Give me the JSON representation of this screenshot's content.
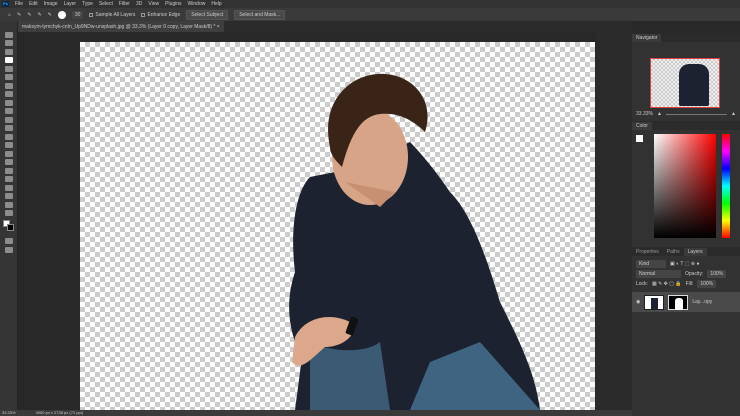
{
  "menu": [
    "File",
    "Edit",
    "Image",
    "Layer",
    "Type",
    "Select",
    "Filter",
    "3D",
    "View",
    "Plugins",
    "Window",
    "Help"
  ],
  "options": {
    "size": "30",
    "sample_all": "Sample All Layers",
    "enhance": "Enhance Edge",
    "select_subject": "Select Subject",
    "select_mask": "Select and Mask..."
  },
  "document_tab": "maksym-tymchyk-cnIn_Up9NDw-unsplash.jpg @ 33.3% (Layer 0 copy, Layer Mask/8) *",
  "status": {
    "zoom": "33.33%",
    "doc": "4000 px x 2738 px (72 ppi)"
  },
  "navigator": {
    "title": "Navigator",
    "zoom": "33.33%"
  },
  "color": {
    "title": "Color"
  },
  "layers": {
    "tabs": [
      "Properties",
      "Paths",
      "Layers"
    ],
    "kind": "Kind",
    "blend": "Normal",
    "opacity_label": "Opacity:",
    "opacity": "100%",
    "lock_label": "Lock:",
    "fill_label": "Fill:",
    "fill": "100%",
    "layer_name": "Lay...opy"
  }
}
